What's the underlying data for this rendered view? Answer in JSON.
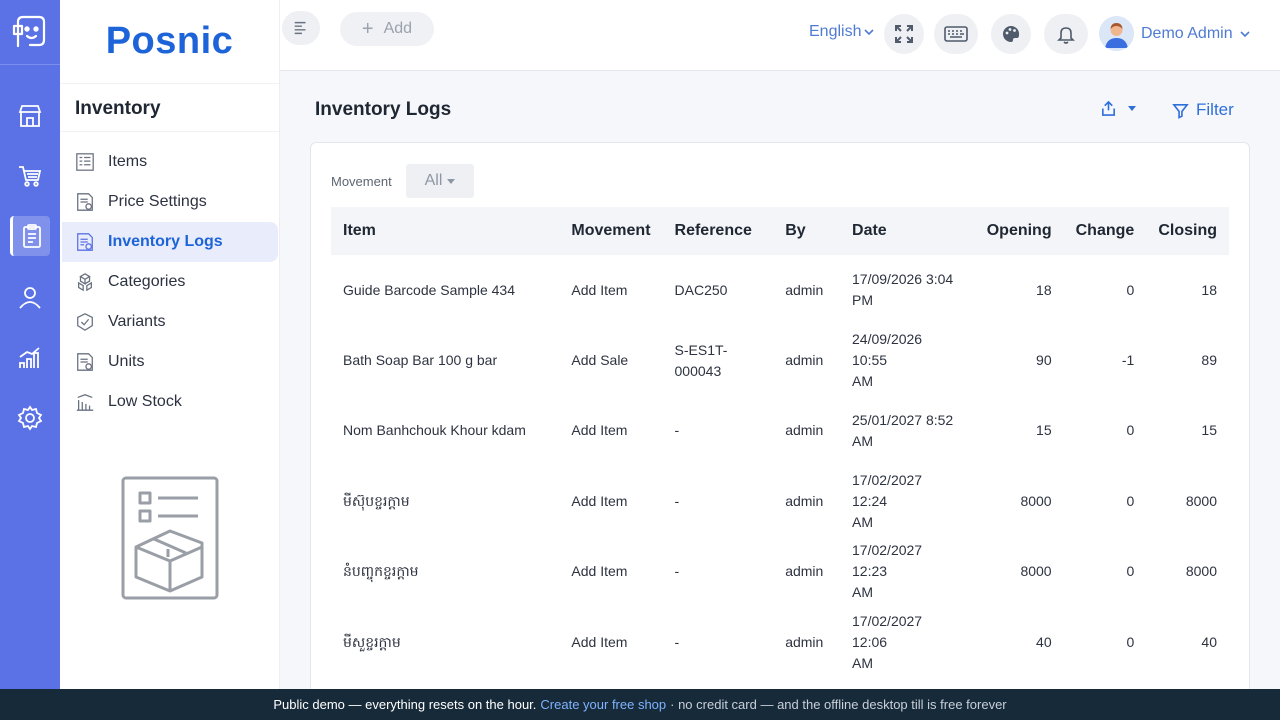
{
  "brand": {
    "name": "Posnic"
  },
  "sidebar": {
    "title": "Inventory",
    "items": [
      {
        "label": "Items",
        "icon": "items-list-icon",
        "active": false
      },
      {
        "label": "Price Settings",
        "icon": "price-settings-icon",
        "active": false
      },
      {
        "label": "Inventory Logs",
        "icon": "inventory-logs-icon",
        "active": true
      },
      {
        "label": "Categories",
        "icon": "categories-icon",
        "active": false
      },
      {
        "label": "Variants",
        "icon": "variants-icon",
        "active": false
      },
      {
        "label": "Units",
        "icon": "units-icon",
        "active": false
      },
      {
        "label": "Low Stock",
        "icon": "low-stock-icon",
        "active": false
      }
    ]
  },
  "rail": {
    "items": [
      {
        "icon": "store-icon",
        "active": false
      },
      {
        "icon": "cart-icon",
        "active": false
      },
      {
        "icon": "clipboard-icon",
        "active": true
      },
      {
        "icon": "user-icon",
        "active": false
      },
      {
        "icon": "chart-icon",
        "active": false
      },
      {
        "icon": "gear-icon",
        "active": false
      }
    ]
  },
  "header": {
    "add_label": "Add",
    "language": "English",
    "user_name": "Demo Admin"
  },
  "page": {
    "title": "Inventory Logs",
    "filter_label": "Filter"
  },
  "filters": {
    "movement_label": "Movement",
    "movement_value": "All"
  },
  "table": {
    "headers": {
      "item": "Item",
      "movement": "Movement",
      "reference": "Reference",
      "by": "By",
      "date": "Date",
      "opening": "Opening",
      "change": "Change",
      "closing": "Closing"
    },
    "rows": [
      {
        "item": "Guide Barcode Sample 434",
        "movement": "Add Item",
        "reference": "DAC250",
        "by": "admin",
        "date_line1": "17/09/2026 3:04",
        "date_line2": "PM",
        "opening": "18",
        "change": "0",
        "closing": "18"
      },
      {
        "item": "Bath Soap Bar 100 g bar",
        "movement": "Add Sale",
        "reference_line1": "S-ES1T-",
        "reference_line2": "000043",
        "by": "admin",
        "date_line1": "24/09/2026 10:55",
        "date_line2": "AM",
        "opening": "90",
        "change": "-1",
        "closing": "89"
      },
      {
        "item": "Nom Banhchouk Khour kdam",
        "movement": "Add Item",
        "reference": "-",
        "by": "admin",
        "date_line1": "25/01/2027 8:52",
        "date_line2": "AM",
        "opening": "15",
        "change": "0",
        "closing": "15"
      },
      {
        "item": "មីស៊ុបខ្ចរក្ដាម",
        "movement": "Add Item",
        "reference": "-",
        "by": "admin",
        "date_line1": "17/02/2027 12:24",
        "date_line2": "AM",
        "opening": "8000",
        "change": "0",
        "closing": "8000"
      },
      {
        "item": "នំបញ្ចុកខ្ចរក្ដាម",
        "movement": "Add Item",
        "reference": "-",
        "by": "admin",
        "date_line1": "17/02/2027 12:23",
        "date_line2": "AM",
        "opening": "8000",
        "change": "0",
        "closing": "8000"
      },
      {
        "item": "មីសួខ្ចរក្ដាម",
        "movement": "Add Item",
        "reference": "-",
        "by": "admin",
        "date_line1": "17/02/2027 12:06",
        "date_line2": "AM",
        "opening": "40",
        "change": "0",
        "closing": "40"
      }
    ]
  },
  "banner": {
    "text": "Public demo — everything resets on the hour.",
    "link": "Create your free shop",
    "suffix": "· no credit card — and the offline desktop till is free forever"
  },
  "colors": {
    "rail": "#5b72e6",
    "brand": "#1d64d8",
    "accent": "#2f6fdc",
    "active_bg": "#e9ecfb",
    "banner": "#172a3a"
  }
}
